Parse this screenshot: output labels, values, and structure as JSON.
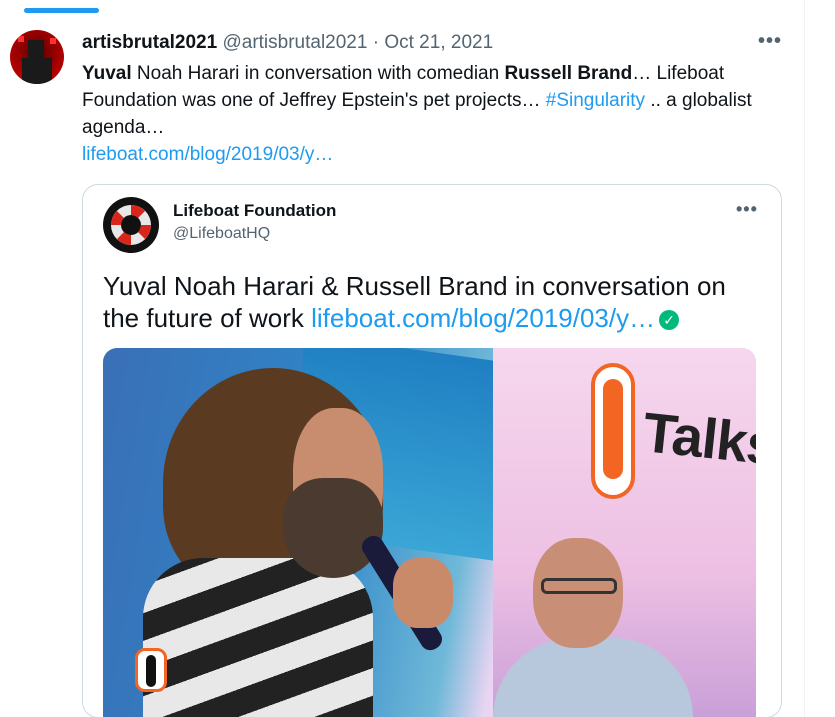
{
  "tweet": {
    "author_name": "artisbrutal2021",
    "handle": "@artisbrutal2021",
    "separator": " · ",
    "date": "Oct 21, 2021",
    "more_label": "•••",
    "text_parts": {
      "p1_bold": "Yuval",
      "p2": " Noah Harari in conversation with comedian ",
      "p3_bold": "Russell Brand",
      "p4": "… Lifeboat Foundation was one of Jeffrey Epstein's pet projects… ",
      "hashtag": "#Singularity",
      "p5": " .. a globalist agenda…"
    },
    "link": "lifeboat.com/blog/2019/03/y…"
  },
  "quoted": {
    "name": "Lifeboat Foundation",
    "handle": "@LifeboatHQ",
    "more_label": "•••",
    "text": "Yuval Noah Harari & Russell Brand in conversation on the future of work ",
    "link": "lifeboat.com/blog/2019/03/y…",
    "verified_mark": "✓",
    "photo": {
      "sign_text": "Talks"
    }
  },
  "colors": {
    "link": "#1d9bf0",
    "text": "#0f1419",
    "muted": "#536471",
    "border": "#cfd9de",
    "accent": "#1d9bf0",
    "verified": "#00ba7c"
  },
  "icons": [
    "more-icon",
    "verified-icon",
    "lifeboat-logo",
    "penguin-logo"
  ]
}
